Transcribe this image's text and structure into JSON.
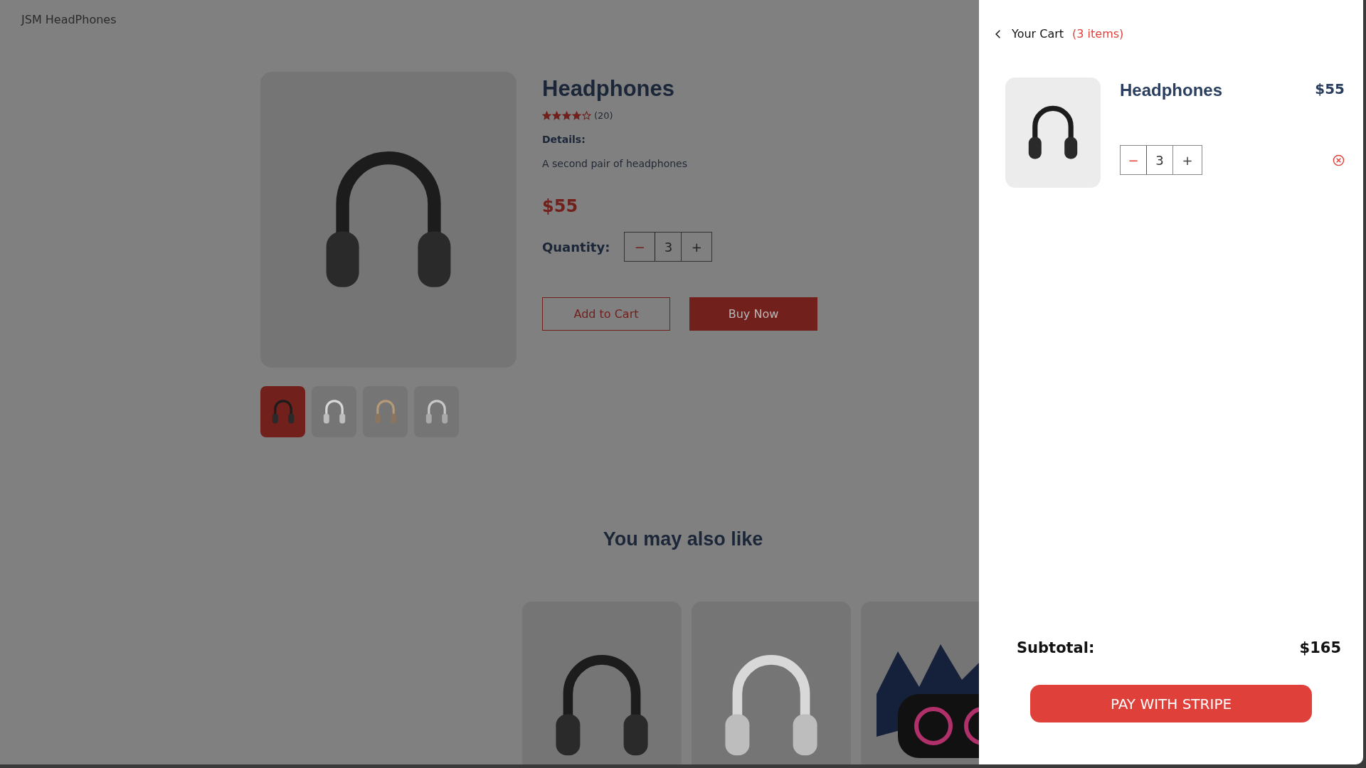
{
  "brand": "JSM HeadPhones",
  "product": {
    "title": "Headphones",
    "stars": 4,
    "reviews": "(20)",
    "details_label": "Details:",
    "details": "A second pair of headphones",
    "price": "$55",
    "quantity_label": "Quantity:",
    "quantity": {
      "minus": "−",
      "value": "3",
      "plus": "+"
    },
    "buttons": [
      {
        "label": "Add to Cart",
        "kind": "outline"
      },
      {
        "label": "Buy Now",
        "kind": "filled"
      }
    ]
  },
  "thumbnails": [
    {
      "selected": true,
      "kind": "black"
    },
    {
      "selected": false,
      "kind": "white"
    },
    {
      "selected": false,
      "kind": "beige"
    },
    {
      "selected": false,
      "kind": "silver"
    }
  ],
  "related": {
    "title": "You may also like",
    "items": [
      {
        "kind": "black"
      },
      {
        "kind": "white"
      },
      {
        "kind": "speaker"
      }
    ]
  },
  "cart": {
    "title": "Your Cart",
    "count": "(3 items)",
    "items": [
      {
        "name": "Headphones",
        "price": "$55",
        "quantity": {
          "minus": "−",
          "value": "3",
          "plus": "+"
        }
      }
    ],
    "subtotal_label": "Subtotal:",
    "subtotal": "$165",
    "checkout": "PAY WITH STRIPE"
  }
}
